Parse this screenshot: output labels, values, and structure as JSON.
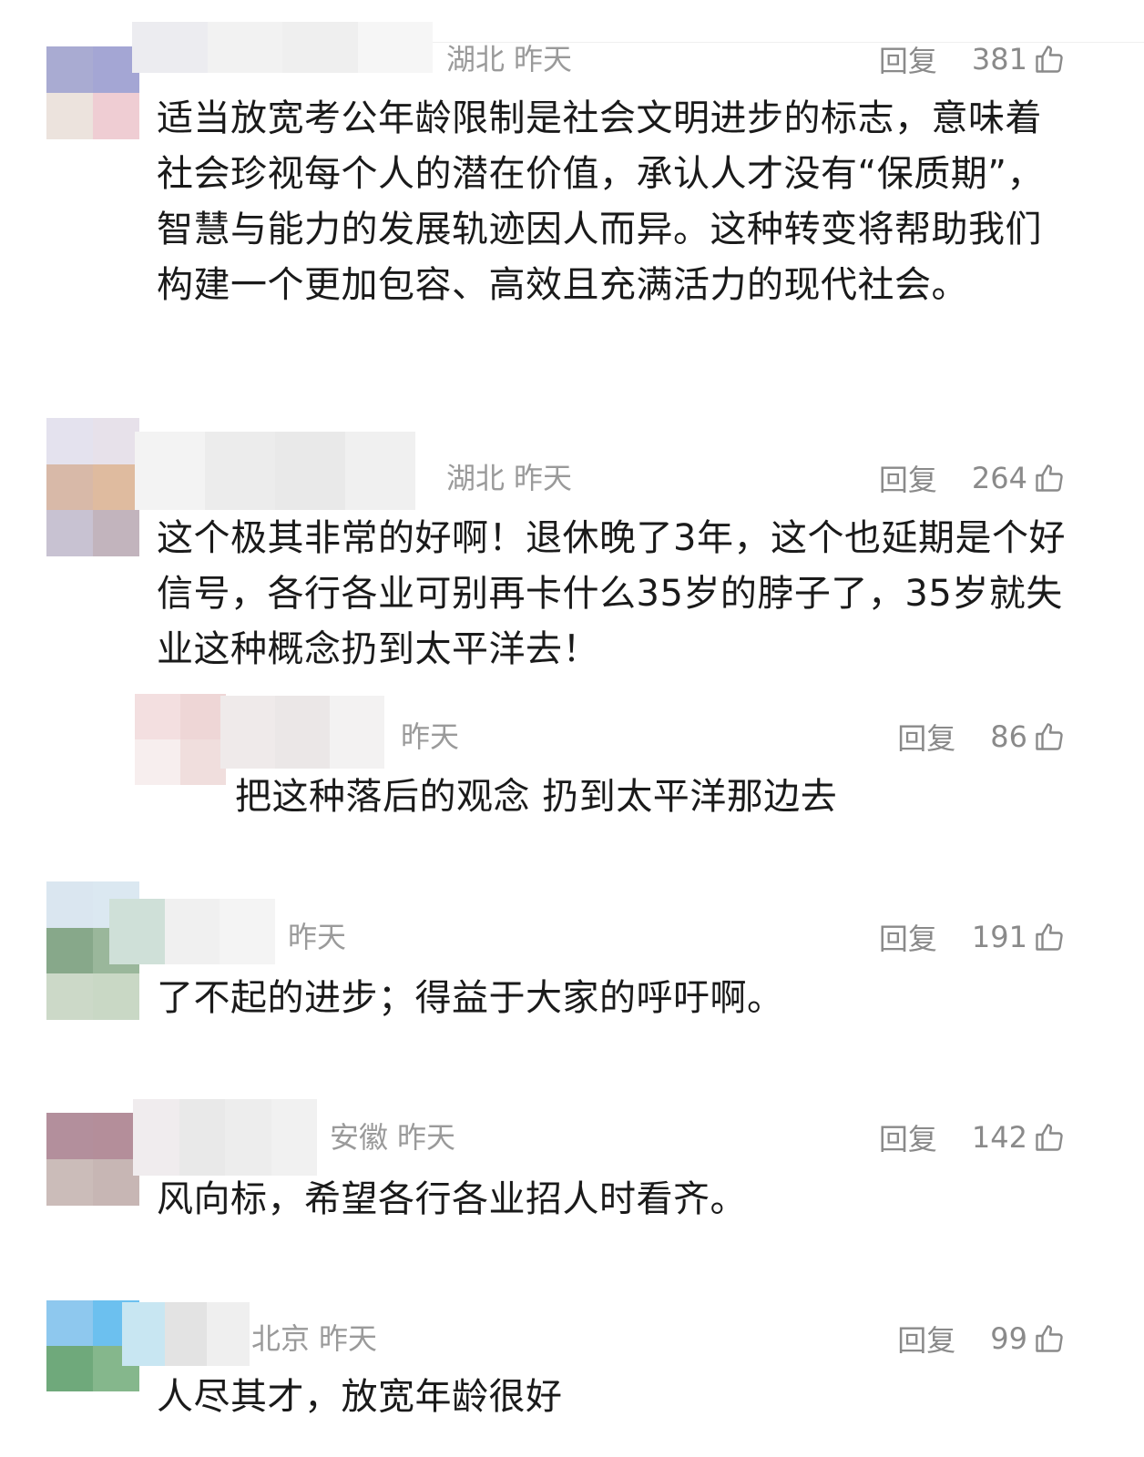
{
  "reply_label": "回复",
  "comments": [
    {
      "location": "湖北",
      "time": "昨天",
      "likes": "381",
      "text": "适当放宽考公年龄限制是社会文明进步的标志，意味着社会珍视每个人的潜在价值，承认人才没有“保质期”，智慧与能力的发展轨迹因人而异。这种转变将帮助我们构建一个更加包容、高效且充满活力的现代社会。"
    },
    {
      "location": "湖北",
      "time": "昨天",
      "likes": "264",
      "text": "这个极其非常的好啊！退休晚了3年，这个也延期是个好信号，各行各业可别再卡什么35岁的脖子了，35岁就失业这种概念扔到太平洋去！"
    },
    {
      "location": "",
      "time": "昨天",
      "likes": "86",
      "text": "把这种落后的观念 扔到太平洋那边去"
    },
    {
      "location": "",
      "time": "昨天",
      "likes": "191",
      "text": "了不起的进步；得益于大家的呼吁啊。"
    },
    {
      "location": "安徽",
      "time": "昨天",
      "likes": "142",
      "text": "风向标，希望各行各业招人时看齐。"
    },
    {
      "location": "北京",
      "time": "昨天",
      "likes": "99",
      "text": "人尽其才，放宽年龄很好"
    }
  ]
}
